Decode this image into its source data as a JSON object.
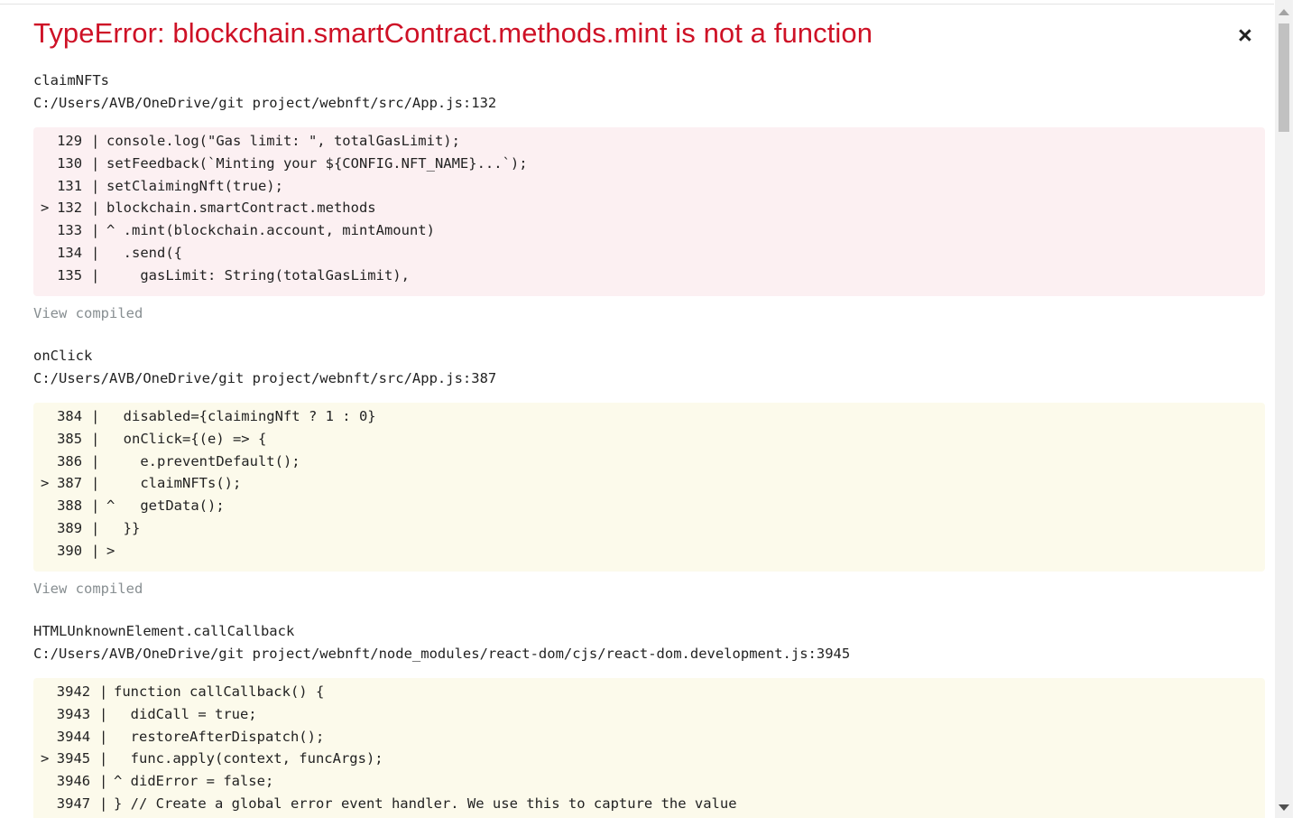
{
  "error_title": "TypeError: blockchain.smartContract.methods.mint is not a function",
  "close_label": "×",
  "view_compiled_label": "View compiled",
  "frames": [
    {
      "name": "claimNFTs",
      "path": "C:/Users/AVB/OneDrive/git project/webnft/src/App.js:132",
      "lines": [
        {
          "marker": "",
          "num": "129",
          "sep": "|",
          "code": "console.log(\"Gas limit: \", totalGasLimit);"
        },
        {
          "marker": "",
          "num": "130",
          "sep": "|",
          "code": "setFeedback(`Minting your ${CONFIG.NFT_NAME}...`);"
        },
        {
          "marker": "",
          "num": "131",
          "sep": "|",
          "code": "setClaimingNft(true);"
        },
        {
          "marker": ">",
          "num": "132",
          "sep": "|",
          "code": "blockchain.smartContract.methods"
        },
        {
          "marker": "",
          "num": "133",
          "sep": "|",
          "code": "^ .mint(blockchain.account, mintAmount)"
        },
        {
          "marker": "",
          "num": "134",
          "sep": "|",
          "code": "  .send({"
        },
        {
          "marker": "",
          "num": "135",
          "sep": "|",
          "code": "    gasLimit: String(totalGasLimit),"
        }
      ]
    },
    {
      "name": "onClick",
      "path": "C:/Users/AVB/OneDrive/git project/webnft/src/App.js:387",
      "lines": [
        {
          "marker": "",
          "num": "384",
          "sep": "|",
          "code": "  disabled={claimingNft ? 1 : 0}"
        },
        {
          "marker": "",
          "num": "385",
          "sep": "|",
          "code": "  onClick={(e) => {"
        },
        {
          "marker": "",
          "num": "386",
          "sep": "|",
          "code": "    e.preventDefault();"
        },
        {
          "marker": ">",
          "num": "387",
          "sep": "|",
          "code": "    claimNFTs();"
        },
        {
          "marker": "",
          "num": "388",
          "sep": "|",
          "code": "^   getData();"
        },
        {
          "marker": "",
          "num": "389",
          "sep": "|",
          "code": "  }}"
        },
        {
          "marker": "",
          "num": "390",
          "sep": "|",
          "code": ">"
        }
      ]
    },
    {
      "name": "HTMLUnknownElement.callCallback",
      "path": "C:/Users/AVB/OneDrive/git project/webnft/node_modules/react-dom/cjs/react-dom.development.js:3945",
      "lines": [
        {
          "marker": "",
          "num": "3942",
          "sep": "|",
          "code": "function callCallback() {"
        },
        {
          "marker": "",
          "num": "3943",
          "sep": "|",
          "code": "  didCall = true;"
        },
        {
          "marker": "",
          "num": "3944",
          "sep": "|",
          "code": "  restoreAfterDispatch();"
        },
        {
          "marker": ">",
          "num": "3945",
          "sep": "|",
          "code": "  func.apply(context, funcArgs);"
        },
        {
          "marker": "",
          "num": "3946",
          "sep": "|",
          "code": "^ didError = false;"
        },
        {
          "marker": "",
          "num": "3947",
          "sep": "|",
          "code": "} // Create a global error event handler. We use this to capture the value"
        }
      ]
    }
  ],
  "colors": {
    "title": "#ce1126",
    "red_box": "#fcf0f2",
    "yellow_box": "#fcfaeb"
  }
}
